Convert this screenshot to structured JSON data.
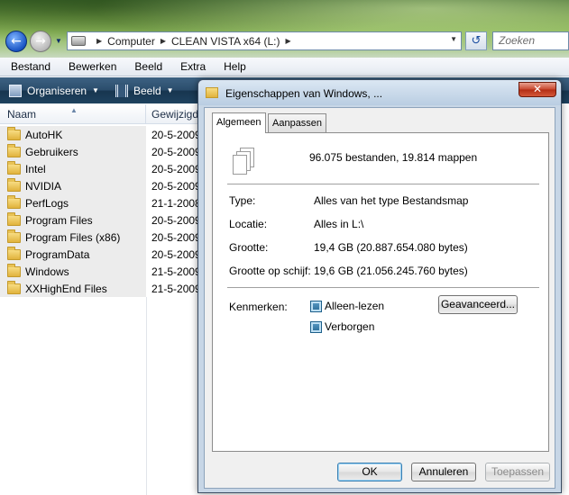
{
  "explorer": {
    "address": {
      "crumbs": [
        "Computer",
        "CLEAN VISTA x64 (L:)"
      ]
    },
    "search_placeholder": "Zoeken",
    "menu": [
      "Bestand",
      "Bewerken",
      "Beeld",
      "Extra",
      "Help"
    ],
    "toolbar": {
      "organize_label": "Organiseren",
      "view_label": "Beeld"
    },
    "columns": {
      "name": "Naam",
      "modified": "Gewijzigd"
    },
    "files": [
      {
        "name": "AutoHK",
        "date": "20-5-2009"
      },
      {
        "name": "Gebruikers",
        "date": "20-5-2009"
      },
      {
        "name": "Intel",
        "date": "20-5-2009"
      },
      {
        "name": "NVIDIA",
        "date": "20-5-2009"
      },
      {
        "name": "PerfLogs",
        "date": "21-1-2008"
      },
      {
        "name": "Program Files",
        "date": "20-5-2009"
      },
      {
        "name": "Program Files (x86)",
        "date": "20-5-2009"
      },
      {
        "name": "ProgramData",
        "date": "20-5-2009"
      },
      {
        "name": "Windows",
        "date": "21-5-2009"
      },
      {
        "name": "XXHighEnd Files",
        "date": "21-5-2009"
      }
    ]
  },
  "dialog": {
    "title": "Eigenschappen van Windows, ...",
    "tabs": [
      "Algemeen",
      "Aanpassen"
    ],
    "summary": "96.075 bestanden, 19.814 mappen",
    "properties": [
      {
        "label": "Type:",
        "value": "Alles van het type Bestandsmap"
      },
      {
        "label": "Locatie:",
        "value": "Alles in L:\\"
      },
      {
        "label": "Grootte:",
        "value": "19,4 GB (20.887.654.080 bytes)"
      },
      {
        "label": "Grootte op schijf:",
        "value": "19,6 GB (21.056.245.760 bytes)"
      }
    ],
    "attributes_label": "Kenmerken:",
    "attributes": [
      {
        "label": "Alleen-lezen",
        "state": "indeterminate"
      },
      {
        "label": "Verborgen",
        "state": "indeterminate"
      }
    ],
    "advanced_label": "Geavanceerd...",
    "buttons": {
      "ok": "OK",
      "cancel": "Annuleren",
      "apply": "Toepassen"
    }
  }
}
